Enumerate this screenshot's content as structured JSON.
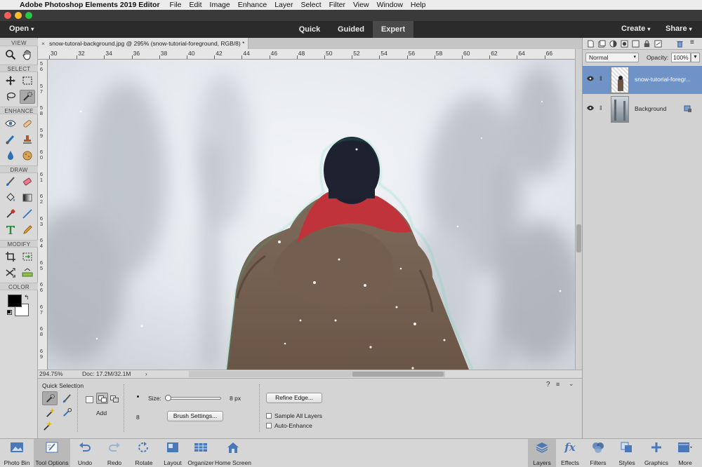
{
  "menubar": {
    "app": "Adobe Photoshop Elements 2019 Editor",
    "items": [
      "File",
      "Edit",
      "Image",
      "Enhance",
      "Layer",
      "Select",
      "Filter",
      "View",
      "Window",
      "Help"
    ]
  },
  "appbar": {
    "open": "Open",
    "modes": [
      "Quick",
      "Guided",
      "Expert"
    ],
    "active_mode": "Expert",
    "create": "Create",
    "share": "Share"
  },
  "toolbox": {
    "sections": [
      "VIEW",
      "SELECT",
      "ENHANCE",
      "DRAW",
      "MODIFY",
      "COLOR"
    ],
    "foreground_color": "#000000",
    "background_color": "#ffffff"
  },
  "document": {
    "tab_title": "snow-tutoral-background.jpg @ 295% (snow-tutorial-foreground, RGB/8) *",
    "ruler_h": [
      "30",
      "32",
      "34",
      "36",
      "38",
      "40",
      "42",
      "44",
      "46",
      "48",
      "50",
      "52",
      "54",
      "56",
      "58",
      "60",
      "62",
      "64",
      "66"
    ],
    "ruler_v": [
      "5\n6",
      "5\n7",
      "5\n8",
      "5\n9",
      "6\n0",
      "6\n1",
      "6\n2",
      "6\n3",
      "6\n4",
      "6\n5",
      "6\n6",
      "6\n7",
      "6\n8",
      "6\n9"
    ],
    "zoom": "294.75%",
    "doc_size": "Doc: 17.2M/32.1M"
  },
  "tool_options": {
    "tool_name": "Quick Selection",
    "add_label": "Add",
    "size_label": "Size:",
    "size_value": "8 px",
    "size_level": 0.02,
    "bullet_value": "8",
    "brush_settings": "Brush Settings...",
    "refine_edge": "Refine Edge...",
    "sample_all_layers": "Sample All Layers",
    "auto_enhance": "Auto-Enhance"
  },
  "layers_panel": {
    "blend_mode": "Normal",
    "opacity_label": "Opacity:",
    "opacity_value": "100%",
    "layers": [
      {
        "name": "snow-tutorial-foregr...",
        "selected": true
      },
      {
        "name": "Background",
        "selected": false
      }
    ]
  },
  "taskbar": {
    "left": [
      "Photo Bin",
      "Tool Options",
      "Undo",
      "Redo",
      "Rotate",
      "Layout",
      "Organizer",
      "Home Screen"
    ],
    "right": [
      "Layers",
      "Effects",
      "Filters",
      "Styles",
      "Graphics",
      "More"
    ]
  },
  "colors": {
    "selection_blue": "#6f93c7",
    "dark_bar": "#2b2b2b"
  }
}
